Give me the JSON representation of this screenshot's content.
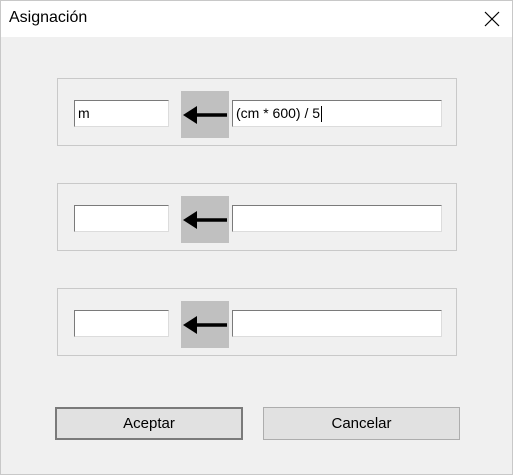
{
  "window": {
    "title": "Asignación"
  },
  "rows": [
    {
      "target": "m",
      "expression": "(cm * 600) / 5"
    },
    {
      "target": "",
      "expression": ""
    },
    {
      "target": "",
      "expression": ""
    }
  ],
  "buttons": {
    "accept": "Aceptar",
    "cancel": "Cancelar"
  },
  "icons": {
    "assign": "left-arrow-icon",
    "close": "close-icon"
  }
}
